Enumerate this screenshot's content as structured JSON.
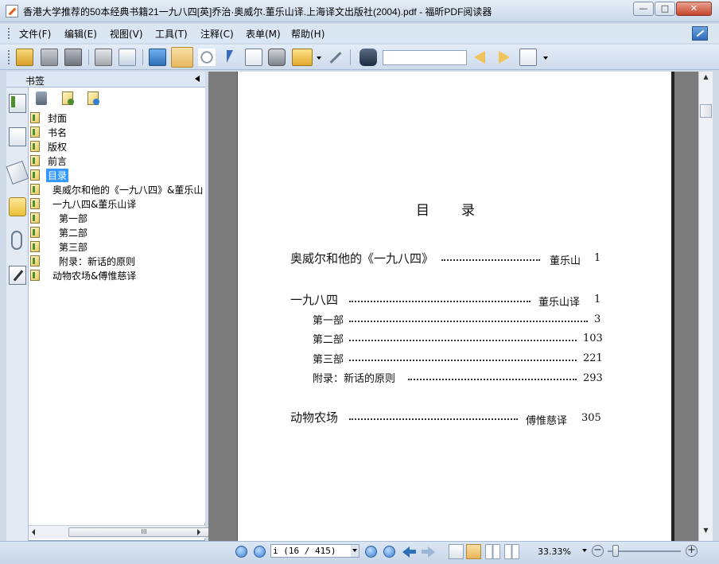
{
  "window": {
    "title": "香港大学推荐的50本经典书籍21一九八四[英]乔治·奥威尔.董乐山译.上海译文出版社(2004).pdf - 福昕PDF阅读器",
    "minimize": "—",
    "maximize": "□",
    "close": "✕"
  },
  "menu": {
    "items": [
      "文件(F)",
      "编辑(E)",
      "视图(V)",
      "工具(T)",
      "注释(C)",
      "表单(M)",
      "帮助(H)"
    ]
  },
  "toolbar": {
    "search_value": "",
    "icons": [
      "open-icon",
      "save-icon",
      "save-as-icon",
      "print-icon",
      "email-icon",
      "fullscreen-icon",
      "hand-tool-icon",
      "zoom-tool-icon",
      "select-arrow-icon",
      "text-select-icon",
      "snapshot-icon",
      "rms-lock-icon",
      "sign-icon",
      "find-binoculars-icon",
      "search-prev-icon",
      "search-next-icon",
      "search-options-icon"
    ]
  },
  "bookmarks": {
    "title": "书签",
    "items": [
      {
        "label": "封面",
        "level": 0
      },
      {
        "label": "书名",
        "level": 0
      },
      {
        "label": "版权",
        "level": 0
      },
      {
        "label": "前言",
        "level": 0
      },
      {
        "label": "目录",
        "level": 0,
        "selected": true
      },
      {
        "label": "奥威尔和他的《一九八四》&董乐山",
        "level": 1
      },
      {
        "label": "一九八四&董乐山译",
        "level": 1
      },
      {
        "label": "第一部",
        "level": 2
      },
      {
        "label": "第二部",
        "level": 2
      },
      {
        "label": "第三部",
        "level": 2
      },
      {
        "label": "附录：新话的原则",
        "level": 2
      },
      {
        "label": "动物农场&傅惟慈译",
        "level": 1
      }
    ],
    "hscroll_grip": "III"
  },
  "page_content": {
    "heading": "目　　录",
    "entries": [
      {
        "title": "奥威尔和他的《一九八四》",
        "author": "董乐山",
        "page": "1"
      },
      {
        "title": "一九八四",
        "author": "董乐山译",
        "page": "1"
      },
      {
        "title": "第一部",
        "author": "",
        "page": "3"
      },
      {
        "title": "第二部",
        "author": "",
        "page": "103"
      },
      {
        "title": "第三部",
        "author": "",
        "page": "221"
      },
      {
        "title": "附录：新话的原则",
        "author": "",
        "page": "293"
      },
      {
        "title": "动物农场",
        "author": "傅惟慈译",
        "page": "305"
      }
    ]
  },
  "status": {
    "page_display": "i (16 / 415)",
    "zoom": "33.33%",
    "zoom_minus": "−",
    "zoom_plus": "+",
    "scroll_up": "▲",
    "scroll_down": "▼"
  }
}
